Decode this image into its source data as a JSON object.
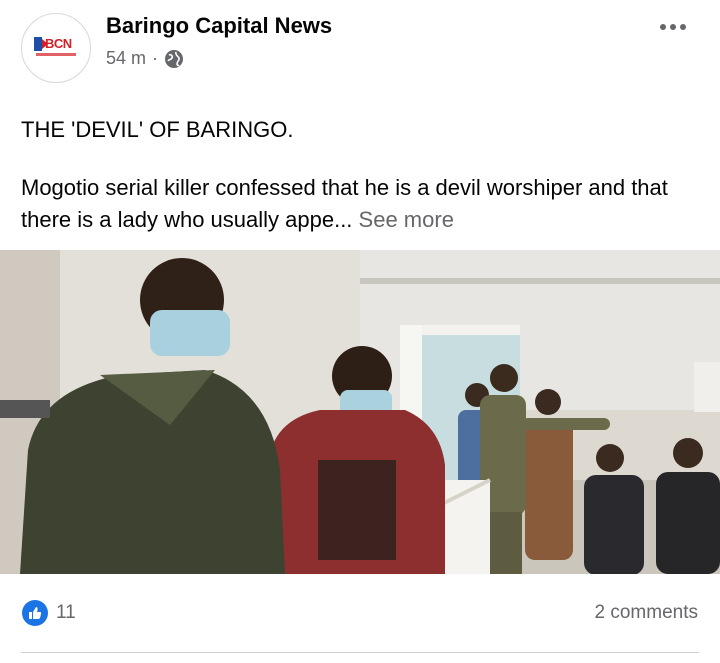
{
  "post": {
    "page_name": "Baringo Capital News",
    "logo_text": "BCN",
    "timestamp": "54 m",
    "separator": "·",
    "audience_icon": "globe-icon",
    "menu_icon": "more-options-icon",
    "caption_title": "THE 'DEVIL' OF BARINGO.",
    "caption_body": "Mogotio serial killer confessed that he is a devil worshiper and that there is a lady who usually appe...",
    "see_more": "See more"
  },
  "reactions": {
    "icon": "thumbs-up-icon",
    "like_count": "11",
    "comments": "2 comments"
  },
  "colors": {
    "accent": "#1b74e4",
    "secondary_text": "#65676b",
    "logo_red": "#d32027",
    "logo_blue": "#1e4ea8"
  }
}
